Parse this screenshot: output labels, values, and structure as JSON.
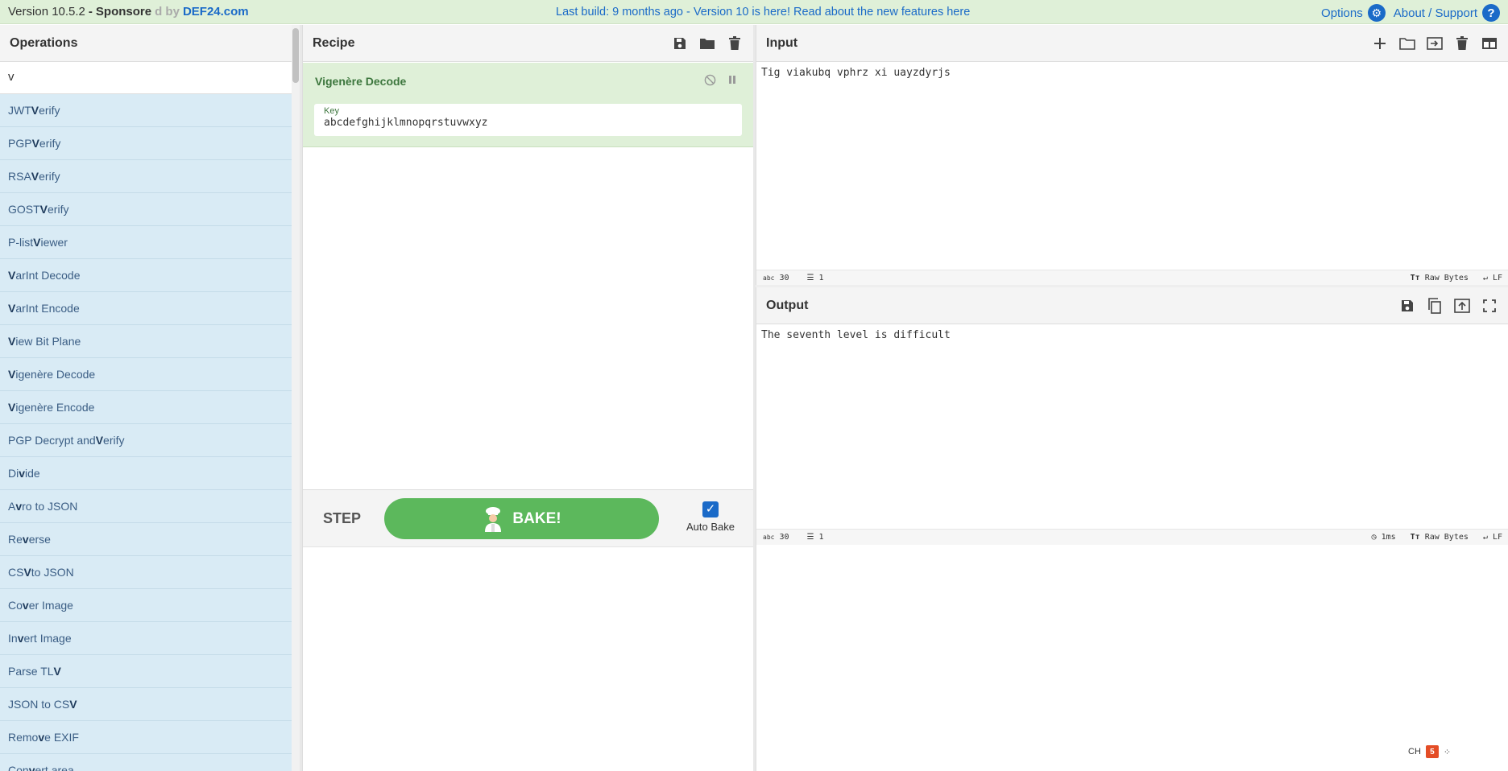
{
  "banner": {
    "version": "Version 10.5.2",
    "dash": "-",
    "sponsored": "Sponsore",
    "sponsored_faded": "d by",
    "brand": "DEF24.com",
    "notice": "Last build: 9 months ago - Version 10 is here! Read about the new features here",
    "options_label": "Options",
    "about_label": "About / Support"
  },
  "operations": {
    "title": "Operations",
    "search_value": "v",
    "items": [
      {
        "pre": "JWT ",
        "hl": "V",
        "post": "erify"
      },
      {
        "pre": "PGP ",
        "hl": "V",
        "post": "erify"
      },
      {
        "pre": "RSA ",
        "hl": "V",
        "post": "erify"
      },
      {
        "pre": "GOST ",
        "hl": "V",
        "post": "erify"
      },
      {
        "pre": "P-list ",
        "hl": "V",
        "post": "iewer"
      },
      {
        "pre": "",
        "hl": "V",
        "post": "arInt Decode"
      },
      {
        "pre": "",
        "hl": "V",
        "post": "arInt Encode"
      },
      {
        "pre": "",
        "hl": "V",
        "post": "iew Bit Plane"
      },
      {
        "pre": "",
        "hl": "V",
        "post": "igenère Decode"
      },
      {
        "pre": "",
        "hl": "V",
        "post": "igenère Encode"
      },
      {
        "pre": "PGP Decrypt and ",
        "hl": "V",
        "post": "erify"
      },
      {
        "pre": "Di",
        "hl": "v",
        "post": "ide"
      },
      {
        "pre": "A",
        "hl": "v",
        "post": "ro to JSON"
      },
      {
        "pre": "Re",
        "hl": "v",
        "post": "erse"
      },
      {
        "pre": "CS",
        "hl": "V",
        "post": " to JSON"
      },
      {
        "pre": "Co",
        "hl": "v",
        "post": "er Image"
      },
      {
        "pre": "In",
        "hl": "v",
        "post": "ert Image"
      },
      {
        "pre": "Parse TL",
        "hl": "V",
        "post": ""
      },
      {
        "pre": "JSON to CS",
        "hl": "V",
        "post": ""
      },
      {
        "pre": "Remo",
        "hl": "v",
        "post": "e EXIF"
      },
      {
        "pre": "Con",
        "hl": "v",
        "post": "ert area"
      }
    ]
  },
  "recipe": {
    "title": "Recipe",
    "operation": {
      "name": "Vigenère Decode",
      "arg_label": "Key",
      "arg_value": "abcdefghijklmnopqrstuvwxyz"
    },
    "step_label": "STEP",
    "bake_label": "BAKE!",
    "autobake_label": "Auto Bake",
    "autobake_checked": true
  },
  "input": {
    "title": "Input",
    "text": "Tig viakubq vphrz xi uayzdyrjs",
    "length": "30",
    "lines": "1",
    "encoding": "Raw Bytes",
    "eol": "LF"
  },
  "output": {
    "title": "Output",
    "text": "The seventh level is difficult",
    "length": "30",
    "lines": "1",
    "time": "1ms",
    "encoding": "Raw Bytes",
    "eol": "LF"
  },
  "tray": {
    "ime": "CH"
  }
}
